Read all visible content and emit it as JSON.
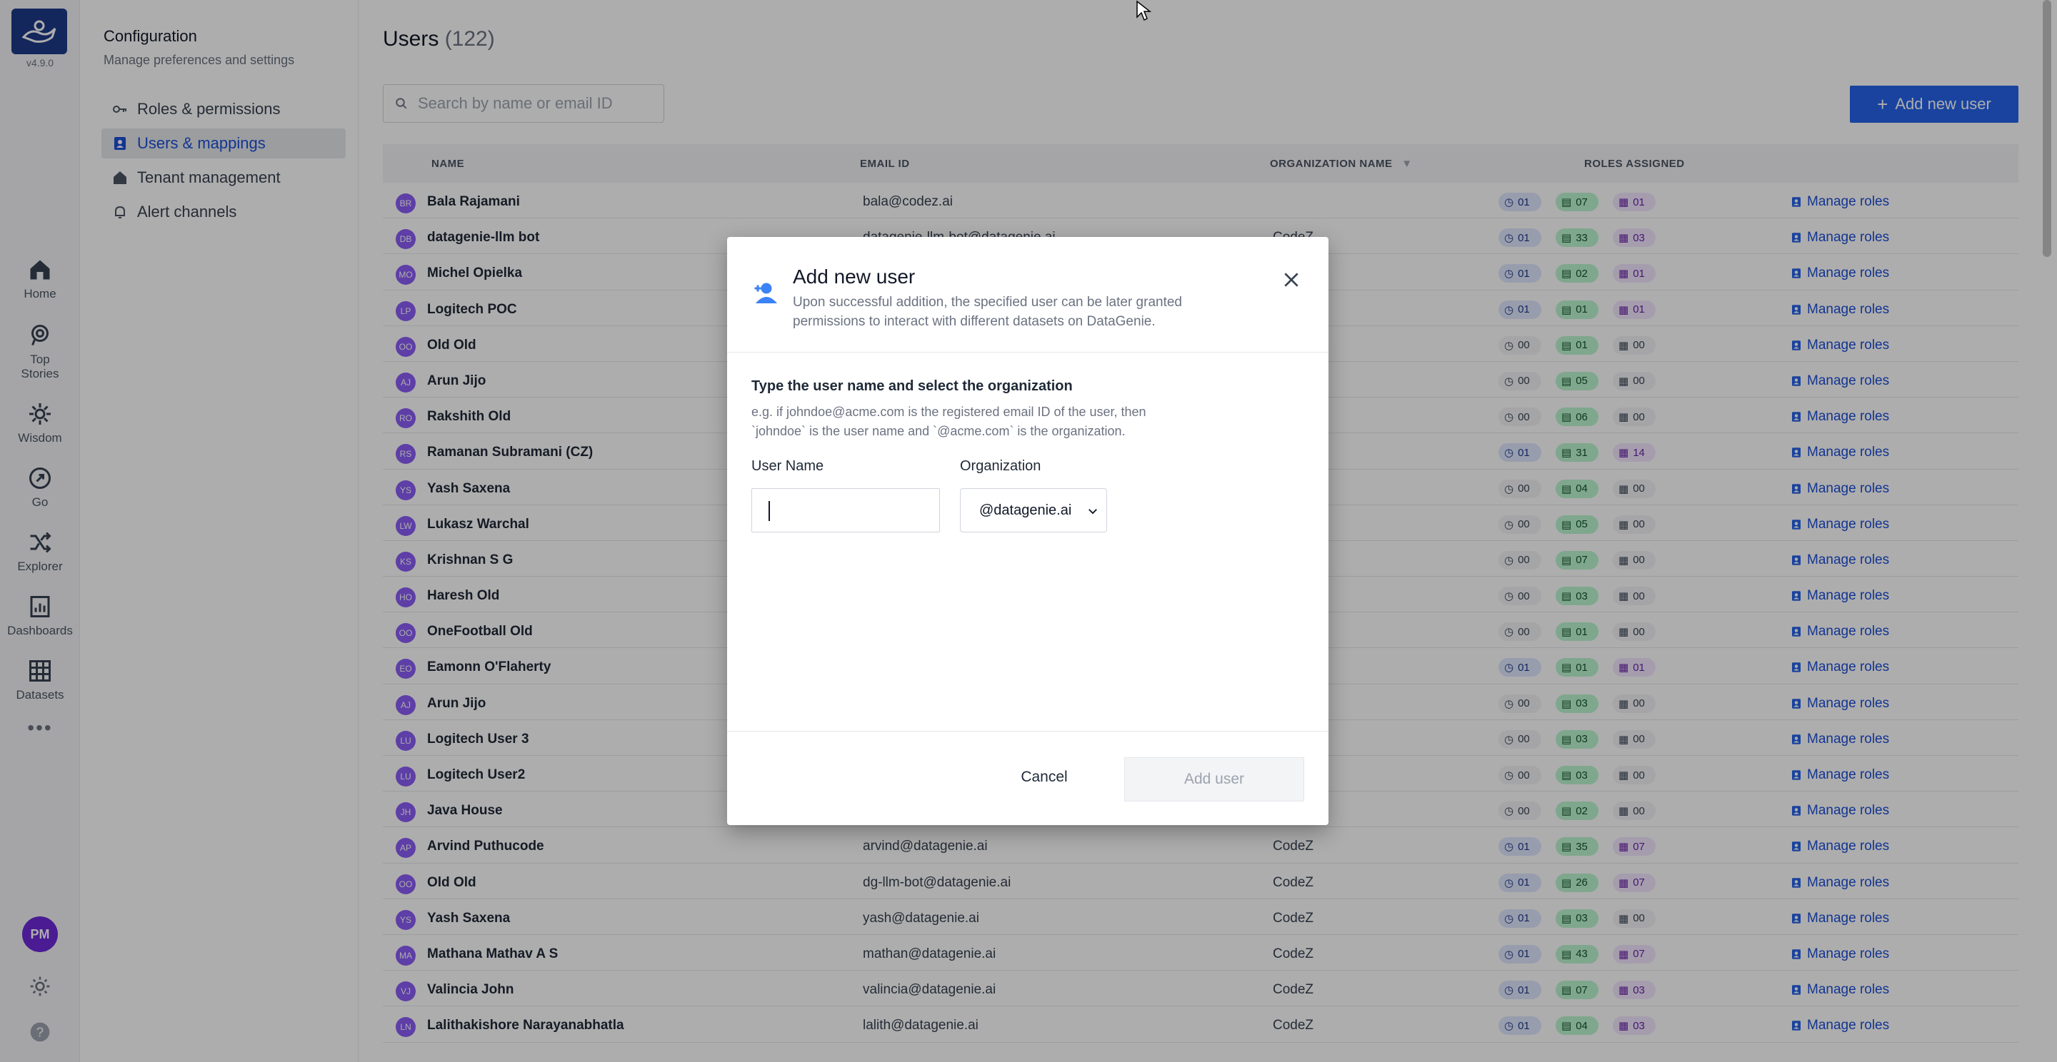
{
  "app": {
    "version": "v4.9.0"
  },
  "rail": {
    "items": [
      {
        "label": "Home",
        "icon": "home-icon"
      },
      {
        "label": "Top Stories",
        "icon": "top-stories-icon"
      },
      {
        "label": "Wisdom",
        "icon": "wisdom-icon"
      },
      {
        "label": "Go",
        "icon": "go-icon"
      },
      {
        "label": "Explorer",
        "icon": "explorer-icon"
      },
      {
        "label": "Dashboards",
        "icon": "dashboards-icon"
      },
      {
        "label": "Datasets",
        "icon": "datasets-icon"
      }
    ],
    "more": "•••",
    "avatar": "PM"
  },
  "config": {
    "title": "Configuration",
    "subtitle": "Manage preferences and settings",
    "items": [
      {
        "label": "Roles & permissions"
      },
      {
        "label": "Users & mappings"
      },
      {
        "label": "Tenant management"
      },
      {
        "label": "Alert channels"
      }
    ]
  },
  "page": {
    "title": "Users",
    "count": "(122)",
    "search_placeholder": "Search by name or email ID",
    "add_button": "Add new user"
  },
  "table": {
    "headers": {
      "name": "NAME",
      "email": "EMAIL ID",
      "org": "ORGANIZATION NAME",
      "roles": "ROLES ASSIGNED"
    },
    "manage_label": "Manage roles",
    "rows": [
      {
        "initials": "BR",
        "name": "Bala Rajamani",
        "email": "bala@codez.ai",
        "org": "",
        "r1": "01",
        "r2": "07",
        "r3": "01"
      },
      {
        "initials": "DB",
        "name": "datagenie-llm bot",
        "email": "datagenie-llm-bot@datagenie.ai",
        "org": "CodeZ",
        "r1": "01",
        "r2": "33",
        "r3": "03"
      },
      {
        "initials": "MO",
        "name": "Michel Opielka",
        "email": "",
        "org": "",
        "r1": "01",
        "r2": "02",
        "r3": "01"
      },
      {
        "initials": "LP",
        "name": "Logitech POC",
        "email": "",
        "org": "",
        "r1": "01",
        "r2": "01",
        "r3": "01"
      },
      {
        "initials": "OO",
        "name": "Old Old",
        "email": "",
        "org": "",
        "r1": "00",
        "r2": "01",
        "r3": "00"
      },
      {
        "initials": "AJ",
        "name": "Arun Jijo",
        "email": "",
        "org": "",
        "r1": "00",
        "r2": "05",
        "r3": "00"
      },
      {
        "initials": "RO",
        "name": "Rakshith Old",
        "email": "",
        "org": "",
        "r1": "00",
        "r2": "06",
        "r3": "00"
      },
      {
        "initials": "RS",
        "name": "Ramanan Subramani (CZ)",
        "email": "",
        "org": "",
        "r1": "01",
        "r2": "31",
        "r3": "14"
      },
      {
        "initials": "YS",
        "name": "Yash Saxena",
        "email": "",
        "org": "",
        "r1": "00",
        "r2": "04",
        "r3": "00"
      },
      {
        "initials": "LW",
        "name": "Lukasz Warchal",
        "email": "",
        "org": "",
        "r1": "00",
        "r2": "05",
        "r3": "00"
      },
      {
        "initials": "KS",
        "name": "Krishnan S G",
        "email": "",
        "org": "",
        "r1": "00",
        "r2": "07",
        "r3": "00"
      },
      {
        "initials": "HO",
        "name": "Haresh Old",
        "email": "",
        "org": "",
        "r1": "00",
        "r2": "03",
        "r3": "00"
      },
      {
        "initials": "OO",
        "name": "OneFootball Old",
        "email": "",
        "org": "",
        "r1": "00",
        "r2": "01",
        "r3": "00"
      },
      {
        "initials": "EO",
        "name": "Eamonn O'Flaherty",
        "email": "",
        "org": "",
        "r1": "01",
        "r2": "01",
        "r3": "01"
      },
      {
        "initials": "AJ",
        "name": "Arun Jijo",
        "email": "",
        "org": "",
        "r1": "00",
        "r2": "03",
        "r3": "00"
      },
      {
        "initials": "LU",
        "name": "Logitech User 3",
        "email": "",
        "org": "",
        "r1": "00",
        "r2": "03",
        "r3": "00"
      },
      {
        "initials": "LU",
        "name": "Logitech User2",
        "email": "",
        "org": "",
        "r1": "00",
        "r2": "03",
        "r3": "00"
      },
      {
        "initials": "JH",
        "name": "Java House",
        "email": "",
        "org": "",
        "r1": "00",
        "r2": "02",
        "r3": "00"
      },
      {
        "initials": "AP",
        "name": "Arvind Puthucode",
        "email": "arvind@datagenie.ai",
        "org": "CodeZ",
        "r1": "01",
        "r2": "35",
        "r3": "07"
      },
      {
        "initials": "OO",
        "name": "Old Old",
        "email": "dg-llm-bot@datagenie.ai",
        "org": "CodeZ",
        "r1": "01",
        "r2": "26",
        "r3": "07"
      },
      {
        "initials": "YS",
        "name": "Yash Saxena",
        "email": "yash@datagenie.ai",
        "org": "CodeZ",
        "r1": "01",
        "r2": "03",
        "r3": "00"
      },
      {
        "initials": "MA",
        "name": "Mathana Mathav A S",
        "email": "mathan@datagenie.ai",
        "org": "CodeZ",
        "r1": "01",
        "r2": "43",
        "r3": "07"
      },
      {
        "initials": "VJ",
        "name": "Valincia John",
        "email": "valincia@datagenie.ai",
        "org": "CodeZ",
        "r1": "01",
        "r2": "07",
        "r3": "03"
      },
      {
        "initials": "LN",
        "name": "Lalithakishore Narayanabhatla",
        "email": "lalith@datagenie.ai",
        "org": "CodeZ",
        "r1": "01",
        "r2": "04",
        "r3": "03"
      }
    ]
  },
  "modal": {
    "title": "Add new user",
    "description": "Upon successful addition, the specified user can be later granted permissions to interact with different datasets on DataGenie.",
    "instruction": "Type the user name and select the organization",
    "example": "e.g. if johndoe@acme.com is the registered email ID of the user, then `johndoe` is the user name and `@acme.com` is the organization.",
    "user_label": "User Name",
    "user_value": "",
    "org_label": "Organization",
    "org_selected": "@datagenie.ai",
    "cancel": "Cancel",
    "submit": "Add user"
  }
}
